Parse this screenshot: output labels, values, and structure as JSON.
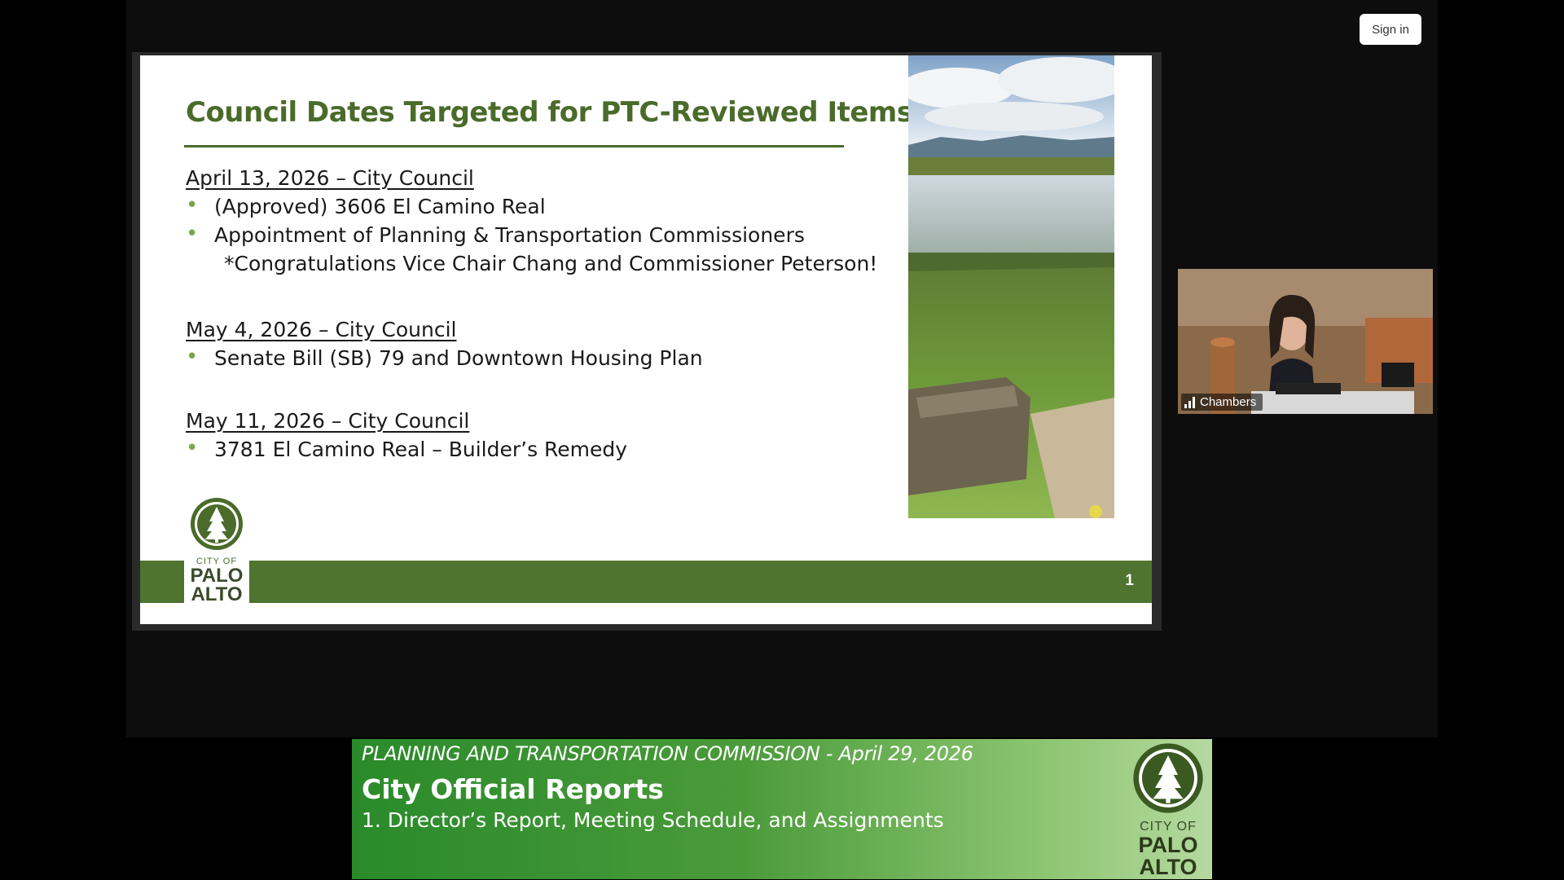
{
  "toolbar": {
    "sign_in_label": "Sign in"
  },
  "slide": {
    "title": "Council Dates Targeted for PTC-Reviewed Items",
    "sections": [
      {
        "heading": "April 13, 2026 – City Council",
        "items": [
          "(Approved) 3606 El Camino Real",
          "Appointment of Planning & Transportation Commissioners"
        ],
        "note": "*Congratulations Vice Chair Chang and Commissioner Peterson!"
      },
      {
        "heading": "May 4, 2026 – City Council",
        "items": [
          "Senate Bill (SB) 79 and Downtown Housing Plan"
        ]
      },
      {
        "heading": "May 11, 2026 – City Council",
        "items": [
          "3781 El Camino Real – Builder’s Remedy"
        ]
      }
    ],
    "bullet_glyph": "•",
    "page_number": "1",
    "logo": {
      "city": "CITY OF",
      "palo": "PALO",
      "alto": "ALTO"
    }
  },
  "video": {
    "label": "Chambers",
    "icon": "signal-bars-icon"
  },
  "banner": {
    "line1": "PLANNING AND TRANSPORTATION COMMISSION - April 29, 2026",
    "line2": "City Official Reports",
    "line3": "1. Director’s Report, Meeting Schedule, and Assignments",
    "logo": {
      "city": "CITY OF",
      "palo": "PALO",
      "alto": "ALTO"
    }
  },
  "colors": {
    "accent_green": "#4a6b2a",
    "footer_green": "#4e7430",
    "bullet_green": "#7aa64a",
    "banner_start": "#2a8a2a",
    "banner_end": "#b5d9a0"
  }
}
